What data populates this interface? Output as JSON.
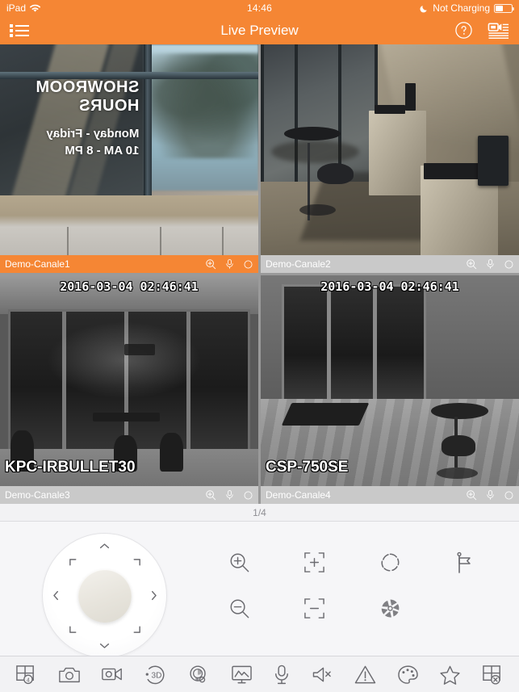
{
  "status_bar": {
    "device": "iPad",
    "wifi_icon": "wifi-icon",
    "time": "14:46",
    "moon_icon": "moon-icon",
    "charging_text": "Not Charging",
    "battery_icon": "battery-icon"
  },
  "nav_bar": {
    "menu_icon": "list-menu-icon",
    "title": "Live Preview",
    "help_icon": "help-circle-icon",
    "device_list_icon": "device-list-icon"
  },
  "accent_color": "#f58634",
  "inactive_bar_color": "#c9c9c9",
  "panels": [
    {
      "channel_label": "Demo-Canale1",
      "selected": true,
      "osd_time": "",
      "osd_name": "",
      "sign_line1": "SHOWROOM HOURS",
      "sign_line2": "Monday - Friday",
      "sign_line3": "10 AM - 8 PM",
      "icons": [
        "zoom-in-icon",
        "microphone-icon",
        "record-icon"
      ]
    },
    {
      "channel_label": "Demo-Canale2",
      "selected": false,
      "osd_time": "",
      "osd_name": "",
      "icons": [
        "zoom-in-icon",
        "microphone-icon",
        "record-icon"
      ]
    },
    {
      "channel_label": "Demo-Canale3",
      "selected": false,
      "osd_time": "2016-03-04 02:46:41",
      "osd_name": "KPC-IRBULLET30",
      "icons": [
        "zoom-in-icon",
        "microphone-icon",
        "record-icon"
      ]
    },
    {
      "channel_label": "Demo-Canale4",
      "selected": false,
      "osd_time": "2016-03-04 02:46:41",
      "osd_name": "CSP-750SE",
      "icons": [
        "zoom-in-icon",
        "microphone-icon",
        "record-icon"
      ]
    }
  ],
  "page_indicator": "1/4",
  "ptz": {
    "dpad_name": "ptz-direction-pad",
    "arrows": [
      "up",
      "up-right",
      "right",
      "down-right",
      "down",
      "down-left",
      "left",
      "up-left"
    ],
    "center_button": "ptz-center-button",
    "functions": [
      {
        "name": "zoom-in-icon",
        "label": "Zoom In"
      },
      {
        "name": "focus-near-icon",
        "label": "Focus +"
      },
      {
        "name": "iris-open-icon",
        "label": "Iris +"
      },
      {
        "name": "preset-flag-icon",
        "label": "Preset"
      },
      {
        "name": "zoom-out-icon",
        "label": "Zoom Out"
      },
      {
        "name": "focus-far-icon",
        "label": "Focus -"
      },
      {
        "name": "iris-close-icon",
        "label": "Iris -"
      }
    ]
  },
  "toolbar": [
    {
      "name": "layout-grid-4-icon",
      "label": "Layout",
      "badge": "4"
    },
    {
      "name": "snapshot-camera-icon",
      "label": "Snapshot"
    },
    {
      "name": "record-video-icon",
      "label": "Record"
    },
    {
      "name": "three-d-positioning-icon",
      "label": "3D",
      "badge": "3D"
    },
    {
      "name": "ptz-control-icon",
      "label": "PTZ"
    },
    {
      "name": "image-display-icon",
      "label": "Display"
    },
    {
      "name": "microphone-icon",
      "label": "Talk"
    },
    {
      "name": "speaker-mute-icon",
      "label": "Audio"
    },
    {
      "name": "alarm-warning-icon",
      "label": "Alarm"
    },
    {
      "name": "palette-icon",
      "label": "Image Color"
    },
    {
      "name": "favorite-star-icon",
      "label": "Favorite"
    },
    {
      "name": "close-all-icon",
      "label": "Close All"
    }
  ]
}
